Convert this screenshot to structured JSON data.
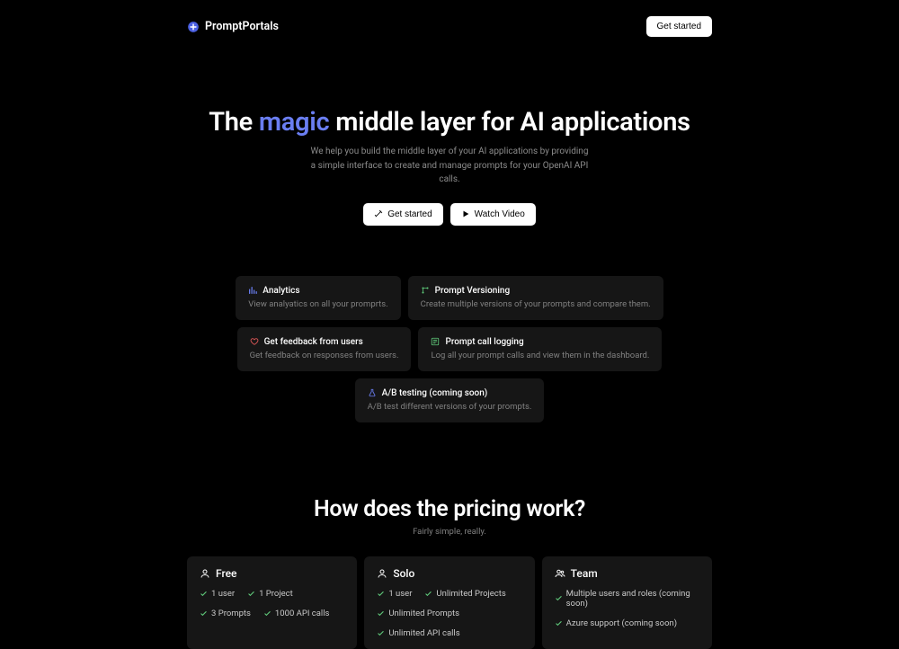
{
  "nav": {
    "brand": "PromptPortals",
    "cta": "Get started"
  },
  "hero": {
    "title_pre": "The ",
    "title_highlight": "magic",
    "title_post": " middle layer for AI applications",
    "subtitle": "We help you build the middle layer of your AI applications by providing a simple interface to create and manage prompts for your OpenAI API calls.",
    "cta_primary": "Get started",
    "cta_secondary": "Watch Video"
  },
  "features": [
    {
      "title": "Analytics",
      "desc": "View analyatics on all your promprts.",
      "color": "#6a7ef2"
    },
    {
      "title": "Prompt Versioning",
      "desc": "Create multiple versions of your prompts and compare them.",
      "color": "#5fc97a"
    },
    {
      "title": "Get feedback from users",
      "desc": "Get feedback on responses from users.",
      "color": "#e85a5a"
    },
    {
      "title": "Prompt call logging",
      "desc": "Log all your prompt calls and view them in the dashboard.",
      "color": "#5fc97a"
    },
    {
      "title": "A/B testing (coming soon)",
      "desc": "A/B test different versions of your prompts.",
      "color": "#6a7ef2"
    }
  ],
  "pricing": {
    "title": "How does the pricing work?",
    "subtitle": "Fairly simple, really."
  },
  "plans": [
    {
      "name": "Free",
      "feats": [
        "1 user",
        "1 Project",
        "3 Prompts",
        "1000 API calls"
      ]
    },
    {
      "name": "Solo",
      "feats": [
        "1 user",
        "Unlimited Projects",
        "Unlimited Prompts",
        "Unlimited API calls"
      ]
    },
    {
      "name": "Team",
      "feats": [
        "Multiple users and roles (coming soon)",
        "Azure support (coming soon)"
      ]
    }
  ]
}
